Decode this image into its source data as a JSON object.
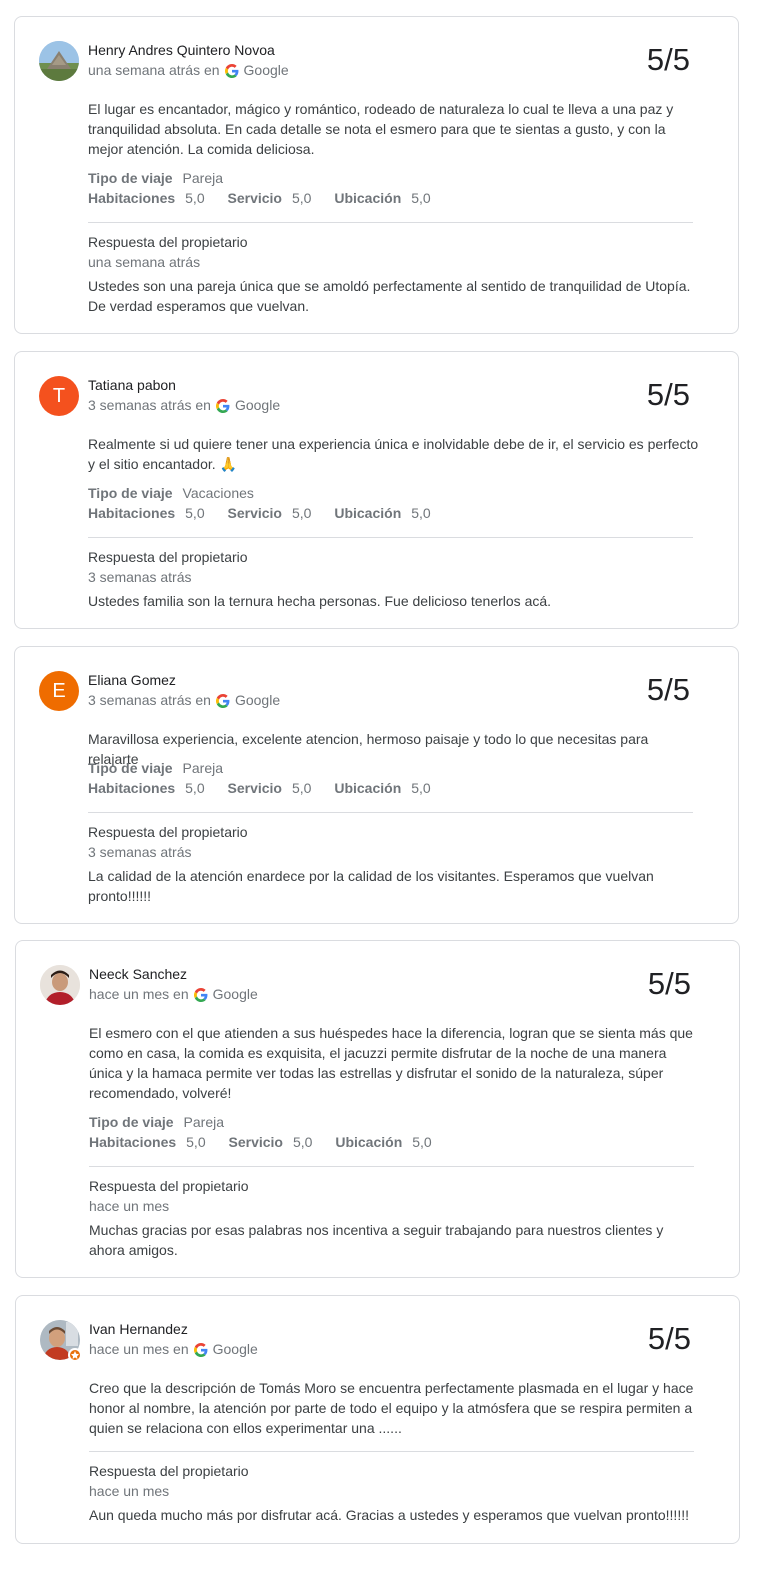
{
  "source_label": "Google",
  "labels": {
    "trip_type": "Tipo de viaje",
    "rooms": "Habitaciones",
    "service": "Servicio",
    "location": "Ubicación",
    "owner_reply": "Respuesta del propietario"
  },
  "colors": {
    "tatiana_avatar": "#f4511e",
    "eliana_avatar": "#ef6c00",
    "card_border": "#dadce0"
  },
  "reviews": [
    {
      "author": "Henry Andres Quintero Novoa",
      "time": "una semana atrás en",
      "avatar_icon": "photo-avatar-pyramid-icon",
      "rating": "5/5",
      "text": "El lugar es encantador, mágico y romántico, rodeado de naturaleza lo cual te lleva a una paz y tranquilidad absoluta. En cada detalle se nota el esmero para que te sientas a gusto, y con la mejor atención. La comida deliciosa.",
      "trip_type": "Pareja",
      "rooms": "5,0",
      "service": "5,0",
      "location": "5,0",
      "reply_time": "una semana atrás",
      "reply_text": "Ustedes son una pareja única que se amoldó perfectamente al sentido de tranquilidad de Utopía. De verdad esperamos que vuelvan."
    },
    {
      "author": "Tatiana pabon",
      "time": "3 semanas atrás en",
      "avatar_letter": "T",
      "rating": "5/5",
      "text": "Realmente si ud quiere tener una experiencia única e inolvidable debe de ir, el servicio es perfecto y el sitio encantador. 🙏",
      "trip_type": "Vacaciones",
      "rooms": "5,0",
      "service": "5,0",
      "location": "5,0",
      "reply_time": "3 semanas atrás",
      "reply_text": "Ustedes familia son la ternura hecha personas. Fue delicioso tenerlos acá."
    },
    {
      "author": "Eliana Gomez",
      "time": "3 semanas atrás en",
      "avatar_letter": "E",
      "rating": "5/5",
      "text": "Maravillosa experiencia, excelente atencion, hermoso paisaje y todo lo que necesitas para relajarte",
      "trip_type": "Pareja",
      "rooms": "5,0",
      "service": "5,0",
      "location": "5,0",
      "reply_time": "3 semanas atrás",
      "reply_text": "La calidad de la atención enardece por la calidad de los visitantes. Esperamos que vuelvan pronto!!!!!!"
    },
    {
      "author": "Neeck Sanchez",
      "time": "hace un mes en",
      "avatar_icon": "photo-avatar-person-icon",
      "rating": "5/5",
      "text": "El esmero con el que atienden a sus huéspedes hace la diferencia, logran que se sienta más que como en casa, la comida es exquisita, el jacuzzi permite disfrutar de la noche de una manera única y la hamaca permite ver todas las estrellas y disfrutar el sonido de la naturaleza, súper recomendado, volveré!",
      "trip_type": "Pareja",
      "rooms": "5,0",
      "service": "5,0",
      "location": "5,0",
      "reply_time": "hace un mes",
      "reply_text": "Muchas gracias por esas palabras nos incentiva a seguir trabajando para nuestros clientes y ahora amigos."
    },
    {
      "author": "Ivan Hernandez",
      "time": "hace un mes en",
      "avatar_icon": "photo-avatar-local-guide-icon",
      "rating": "5/5",
      "text": "Creo que la descripción de Tomás Moro se encuentra perfectamente plasmada en el lugar y hace honor al nombre, la atención por parte de todo el equipo y la atmósfera que se respira permiten a quien se relaciona con ellos experimentar una ......",
      "reply_time": "hace un mes",
      "reply_text": "Aun queda mucho más por disfrutar acá. Gracias a ustedes y esperamos que vuelvan pronto!!!!!!"
    }
  ]
}
